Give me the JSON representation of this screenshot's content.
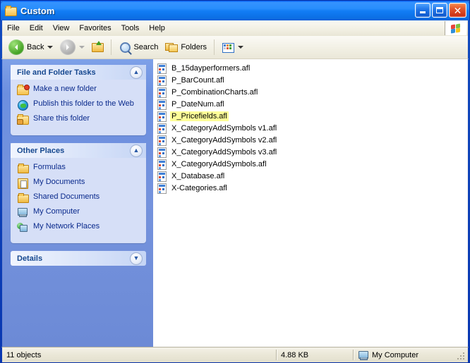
{
  "window": {
    "title": "Custom",
    "icon": "folder-open-icon",
    "controls": {
      "minimize": "Minimize",
      "maximize": "Maximize",
      "close": "Close"
    }
  },
  "menubar": {
    "items": [
      {
        "label": "File"
      },
      {
        "label": "Edit"
      },
      {
        "label": "View"
      },
      {
        "label": "Favorites"
      },
      {
        "label": "Tools"
      },
      {
        "label": "Help"
      }
    ],
    "logo": "windows-flag-icon"
  },
  "toolbar": {
    "back_label": "Back",
    "forward_label": "",
    "up_label": "",
    "search_label": "Search",
    "folders_label": "Folders",
    "views_label": ""
  },
  "sidebar": {
    "panels": [
      {
        "title": "File and Folder Tasks",
        "collapse_glyph": "«",
        "state": "expanded",
        "links": [
          {
            "label": "Make a new folder",
            "icon": "new-folder-icon"
          },
          {
            "label": "Publish this folder to the Web",
            "icon": "globe-publish-icon"
          },
          {
            "label": "Share this folder",
            "icon": "share-folder-icon"
          }
        ]
      },
      {
        "title": "Other Places",
        "collapse_glyph": "«",
        "state": "expanded",
        "links": [
          {
            "label": "Formulas",
            "icon": "folder-icon"
          },
          {
            "label": "My Documents",
            "icon": "my-documents-icon"
          },
          {
            "label": "Shared Documents",
            "icon": "folder-icon"
          },
          {
            "label": "My Computer",
            "icon": "my-computer-icon"
          },
          {
            "label": "My Network Places",
            "icon": "network-places-icon"
          }
        ]
      },
      {
        "title": "Details",
        "collapse_glyph": "»",
        "state": "collapsed",
        "links": []
      }
    ]
  },
  "filelist": {
    "view": "list",
    "items": [
      {
        "name": "B_15dayperformers.afl",
        "icon": "afl-file-icon",
        "selected": false
      },
      {
        "name": "P_BarCount.afl",
        "icon": "afl-file-icon",
        "selected": false
      },
      {
        "name": "P_CombinationCharts.afl",
        "icon": "afl-file-icon",
        "selected": false
      },
      {
        "name": "P_DateNum.afl",
        "icon": "afl-file-icon",
        "selected": false
      },
      {
        "name": "P_Pricefields.afl",
        "icon": "afl-file-icon",
        "selected": true
      },
      {
        "name": "X_CategoryAddSymbols v1.afl",
        "icon": "afl-file-icon",
        "selected": false
      },
      {
        "name": "X_CategoryAddSymbols v2.afl",
        "icon": "afl-file-icon",
        "selected": false
      },
      {
        "name": "X_CategoryAddSymbols v3.afl",
        "icon": "afl-file-icon",
        "selected": false
      },
      {
        "name": "X_CategoryAddSymbols.afl",
        "icon": "afl-file-icon",
        "selected": false
      },
      {
        "name": "X_Database.afl",
        "icon": "afl-file-icon",
        "selected": false
      },
      {
        "name": "X-Categories.afl",
        "icon": "afl-file-icon",
        "selected": false
      }
    ]
  },
  "statusbar": {
    "object_count": "11 objects",
    "size": "4.88 KB",
    "location": "My Computer",
    "location_icon": "my-computer-icon"
  },
  "colors": {
    "title_blue": "#0A57D6",
    "sidebar_blue": "#7191DE",
    "panel_body": "#D6DFF7",
    "panel_head_text": "#16488F",
    "link_text": "#0A2A8C",
    "selection_highlight": "#FFFF99",
    "status_bg": "#ECE9D8"
  }
}
